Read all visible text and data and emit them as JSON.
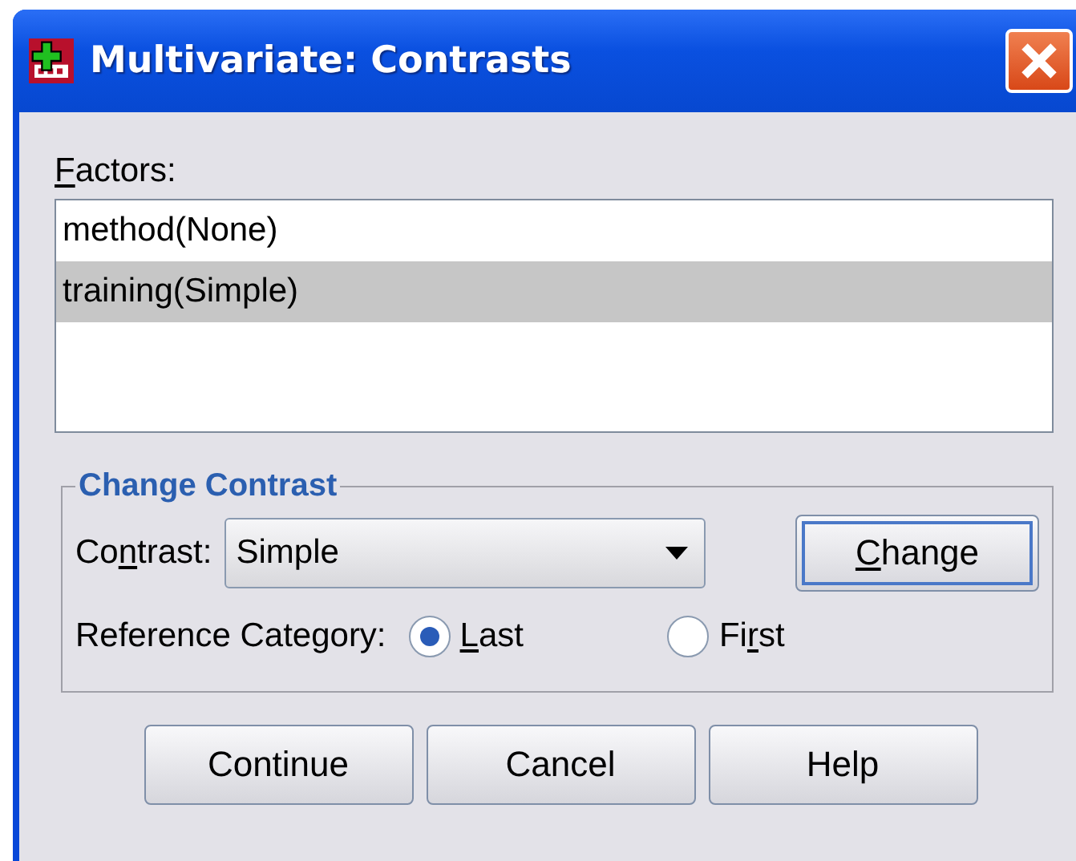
{
  "window": {
    "title": "Multivariate: Contrasts"
  },
  "factors": {
    "label": [
      {
        "text": "F",
        "underlined": true
      },
      {
        "text": "actors:",
        "underlined": false
      }
    ],
    "items": [
      {
        "text": "method(None)",
        "selected": false
      },
      {
        "text": "training(Simple)",
        "selected": true
      }
    ]
  },
  "change_contrast": {
    "title": "Change Contrast",
    "contrast_label": [
      {
        "text": "Co",
        "underlined": false
      },
      {
        "text": "n",
        "underlined": true
      },
      {
        "text": "trast:",
        "underlined": false
      }
    ],
    "contrast_value": "Simple",
    "change_button": [
      {
        "text": "C",
        "underlined": true
      },
      {
        "text": "hange",
        "underlined": false
      }
    ],
    "reference_label": "Reference Category:",
    "reference_options": [
      {
        "label": [
          {
            "text": "L",
            "underlined": true
          },
          {
            "text": "ast",
            "underlined": false
          }
        ],
        "selected": true
      },
      {
        "label": [
          {
            "text": "Fi",
            "underlined": false
          },
          {
            "text": "r",
            "underlined": true
          },
          {
            "text": "st",
            "underlined": false
          }
        ],
        "selected": false
      }
    ]
  },
  "buttons": [
    "Continue",
    "Cancel",
    "Help"
  ]
}
